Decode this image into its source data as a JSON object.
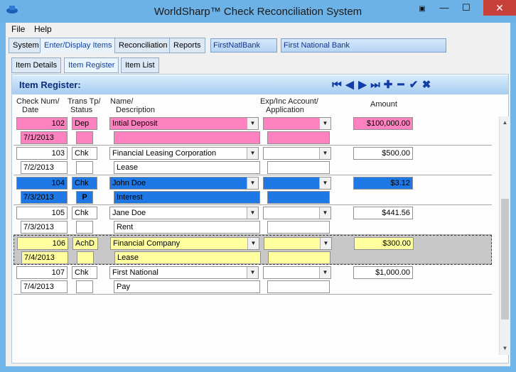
{
  "window": {
    "title": "WorldSharp™ Check Reconciliation System"
  },
  "menu": {
    "file": "File",
    "help": "Help"
  },
  "tabs": [
    {
      "label": "System"
    },
    {
      "label": "Enter/Display Items"
    },
    {
      "label": "Reconciliation"
    },
    {
      "label": "Reports"
    }
  ],
  "bank": {
    "code": "FirstNatlBank",
    "name": "First National Bank"
  },
  "subtabs": [
    {
      "label": "Item Details"
    },
    {
      "label": "Item Register"
    },
    {
      "label": "Item List"
    }
  ],
  "register": {
    "title": "Item Register:",
    "headers": {
      "check_line1": "Check Num/",
      "check_line2": "Date",
      "trans_line1": "Trans Tp/",
      "trans_line2": "Status",
      "name_line1": "Name/",
      "name_line2": "Description",
      "exp_line1": "Exp/Inc Account/",
      "exp_line2": "Application",
      "amount": "Amount"
    }
  },
  "colors": {
    "deposit": "#ff82c0",
    "selected": "#1e78e6",
    "ach": "#ffffa0"
  },
  "rows": [
    {
      "check": "102",
      "trans": "Dep",
      "name": "Intial Deposit",
      "account": "",
      "amount": "$100,000.00",
      "date": "7/1/2013",
      "status": "",
      "description": "",
      "application": "",
      "style": "pink"
    },
    {
      "check": "103",
      "trans": "Chk",
      "name": "Financial Leasing Corporation",
      "account": "",
      "amount": "$500.00",
      "date": "7/2/2013",
      "status": "",
      "description": "Lease",
      "application": "",
      "style": "normal"
    },
    {
      "check": "104",
      "trans": "Chk",
      "name": "John Doe",
      "account": "",
      "amount": "$3.12",
      "date": "7/3/2013",
      "status": "P",
      "description": "Interest",
      "application": "",
      "style": "blue"
    },
    {
      "check": "105",
      "trans": "Chk",
      "name": "Jane Doe",
      "account": "",
      "amount": "$441.56",
      "date": "7/3/2013",
      "status": "",
      "description": "Rent",
      "application": "",
      "style": "normal"
    },
    {
      "check": "106",
      "trans": "AchD",
      "name": "Financial Company",
      "account": "",
      "amount": "$300.00",
      "date": "7/4/2013",
      "status": "",
      "description": "Lease",
      "application": "",
      "style": "yellow"
    },
    {
      "check": "107",
      "trans": "Chk",
      "name": "First National",
      "account": "",
      "amount": "$1,000.00",
      "date": "7/4/2013",
      "status": "",
      "description": "Pay",
      "application": "",
      "style": "normal"
    }
  ]
}
